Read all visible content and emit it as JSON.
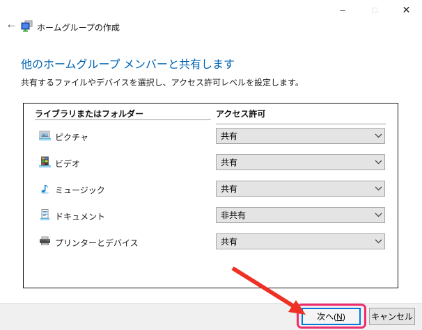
{
  "window": {
    "title": "ホームグループの作成"
  },
  "icons": {
    "back": "←",
    "minimize": "–",
    "maximize": "□",
    "close": "✕",
    "chevron_down": "v-shaped chevron",
    "homegroup": "two networked monitors",
    "pictures": "framed photo on blue base",
    "videos": "film strip on blue base",
    "music": "blue eighth note",
    "documents": "lined page on blue base",
    "printers": "gray printer"
  },
  "header": {
    "heading": "他のホームグループ メンバーと共有します",
    "subtitle": "共有するファイルやデバイスを選択し、アクセス許可レベルを設定します。"
  },
  "table": {
    "columns": [
      "ライブラリまたはフォルダー",
      "アクセス許可"
    ],
    "rows": [
      {
        "icon": "pictures-icon",
        "label": "ピクチャ",
        "permission": "共有"
      },
      {
        "icon": "videos-icon",
        "label": "ビデオ",
        "permission": "共有"
      },
      {
        "icon": "music-icon",
        "label": "ミュージック",
        "permission": "共有"
      },
      {
        "icon": "documents-icon",
        "label": "ドキュメント",
        "permission": "非共有"
      },
      {
        "icon": "printers-icon",
        "label": "プリンターとデバイス",
        "permission": "共有"
      }
    ]
  },
  "footer": {
    "next": {
      "prefix": "次へ(",
      "accesskey": "N",
      "suffix": ")"
    },
    "cancel_label": "キャンセル"
  },
  "colors": {
    "heading_blue": "#0063b1",
    "default_button_border": "#0078d7",
    "annotation_pink": "#ed2d6e",
    "annotation_red": "#ee3124",
    "footer_gray": "#f0f0f0"
  }
}
